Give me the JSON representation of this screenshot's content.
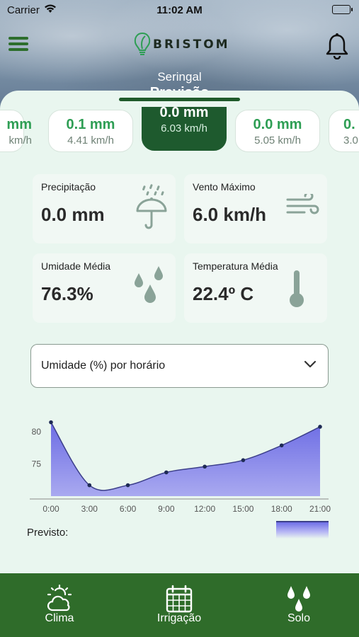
{
  "status_bar": {
    "carrier": "Carrier",
    "time": "11:02 AM"
  },
  "header": {
    "logo_text": "BRISTOM",
    "city": "Seringal",
    "title_partial": "Previsão"
  },
  "days": [
    {
      "mm": "mm",
      "kmh": "km/h",
      "selected": false
    },
    {
      "mm": "0.1 mm",
      "kmh": "4.41 km/h",
      "selected": false
    },
    {
      "mm": "0.0 mm",
      "kmh": "6.03 km/h",
      "selected": true
    },
    {
      "mm": "0.0 mm",
      "kmh": "5.05 km/h",
      "selected": false
    },
    {
      "mm": "0.",
      "kmh": "3.0",
      "selected": false
    }
  ],
  "stats": {
    "precipitation": {
      "label": "Precipitação",
      "value": "0.0 mm",
      "icon": "umbrella-rain-icon"
    },
    "wind": {
      "label": "Vento Máximo",
      "value": "6.0 km/h",
      "icon": "wind-icon"
    },
    "humidity": {
      "label": "Umidade Média",
      "value": "76.3%",
      "icon": "water-drops-icon"
    },
    "temperature": {
      "label": "Temperatura Média",
      "value": "22.4º C",
      "icon": "thermometer-icon"
    }
  },
  "dropdown": {
    "selected": "Umidade (%) por horário"
  },
  "chart_data": {
    "type": "area",
    "x": [
      "0:00",
      "3:00",
      "6:00",
      "9:00",
      "12:00",
      "15:00",
      "18:00",
      "21:00"
    ],
    "series": [
      {
        "values": [
          81.5,
          71.7,
          71.7,
          73.7,
          74.6,
          75.6,
          77.9,
          80.8
        ]
      }
    ],
    "y_ticks": [
      75,
      80
    ],
    "ylim": [
      70,
      83
    ],
    "colors": {
      "fill": "#7b7be8",
      "line": "#3c3f8a"
    },
    "grid": false
  },
  "legend": {
    "label": "Previsto:"
  },
  "tabs": [
    {
      "label": "Clima",
      "icon": "sun-cloud-icon"
    },
    {
      "label": "Irrigação",
      "icon": "calendar-icon"
    },
    {
      "label": "Solo",
      "icon": "water-drops-icon"
    }
  ],
  "colors": {
    "brand": "#2f6c2a",
    "accent": "#2e9e54",
    "sheet": "#e9f6ef"
  }
}
